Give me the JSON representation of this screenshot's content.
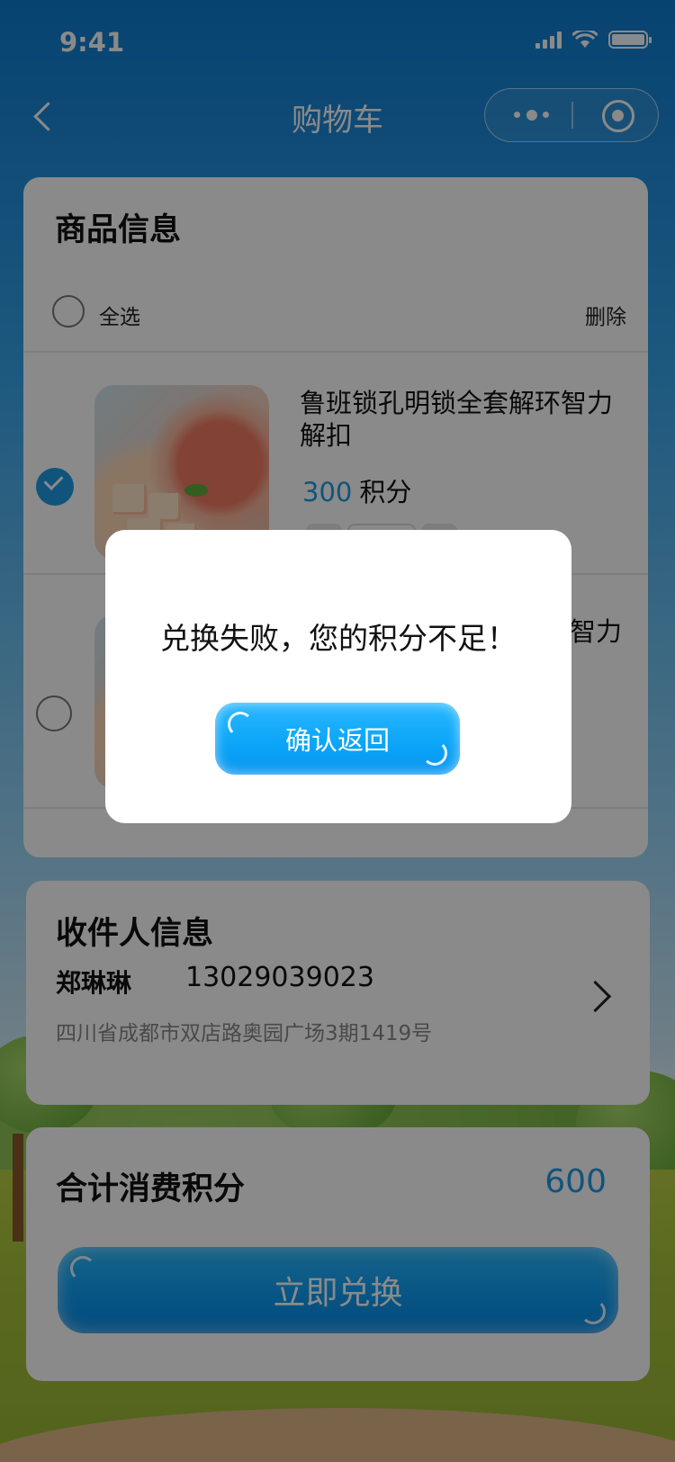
{
  "status_bar": {
    "time": "9:41"
  },
  "nav": {
    "title": "购物车"
  },
  "goods": {
    "section_title": "商品信息",
    "select_all_label": "全选",
    "delete_label": "删除",
    "items": [
      {
        "name": "鲁班锁孔明锁全套解环智力解扣",
        "points": "300",
        "unit": "积分",
        "checked": true
      },
      {
        "name_visible_fragment": "智力",
        "checked": false
      }
    ]
  },
  "receiver": {
    "section_title": "收件人信息",
    "name": "郑琳琳",
    "phone": "13029039023",
    "address": "四川省成都市双店路奥园广场3期1419号"
  },
  "total": {
    "label": "合计消费积分",
    "value": "600",
    "redeem_button": "立即兑换"
  },
  "dialog": {
    "message": "兑换失败，您的积分不足！",
    "confirm_button": "确认返回"
  },
  "colors": {
    "accent": "#1e9be6",
    "button": "#0aa4f8"
  },
  "icons": {
    "back": "back-chevron-icon",
    "more": "more-dots-icon",
    "record": "record-circle-icon",
    "arrow": "chevron-right-icon"
  }
}
